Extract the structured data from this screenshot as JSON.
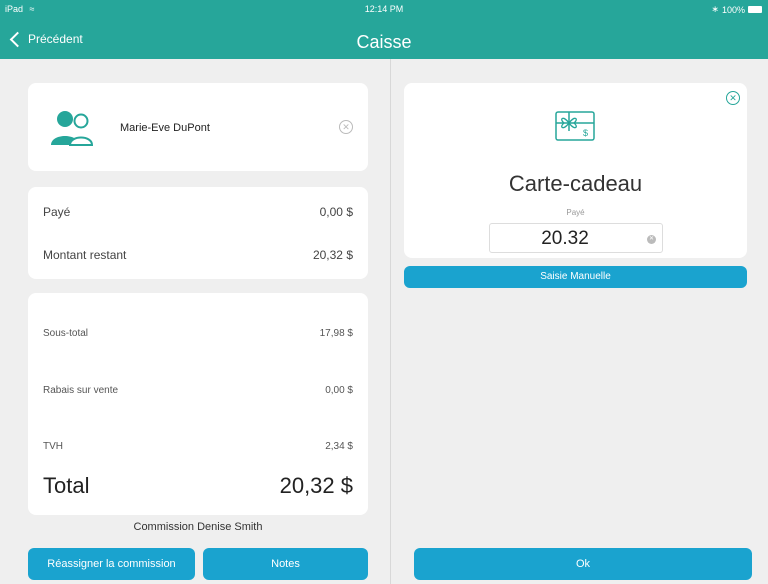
{
  "status_bar": {
    "device": "iPad",
    "time": "12:14 PM",
    "battery": "100%"
  },
  "nav": {
    "back_label": "Précédent",
    "title": "Caisse"
  },
  "client": {
    "name": "Marie-Eve DuPont",
    "clear_icon": "close-circle-icon"
  },
  "payment": {
    "paid_label": "Payé",
    "paid_value": "0,00 $",
    "remaining_label": "Montant restant",
    "remaining_value": "20,32 $"
  },
  "totals": {
    "subtotal_label": "Sous-total",
    "subtotal_value": "17,98 $",
    "discount_label": "Rabais sur vente",
    "discount_value": "0,00 $",
    "tax_label": "TVH",
    "tax_value": "2,34 $",
    "total_label": "Total",
    "total_value": "20,32 $"
  },
  "commission": "Commission Denise Smith",
  "buttons": {
    "reassign": "Réassigner la commission",
    "notes": "Notes",
    "manual": "Saisie Manuelle",
    "ok": "Ok"
  },
  "gift": {
    "title": "Carte-cadeau",
    "paid_label": "Payé",
    "amount": "20.32",
    "icon": "gift-card-icon"
  },
  "colors": {
    "header": "#26a69a",
    "button": "#1aa3cf",
    "background": "#efefef"
  }
}
